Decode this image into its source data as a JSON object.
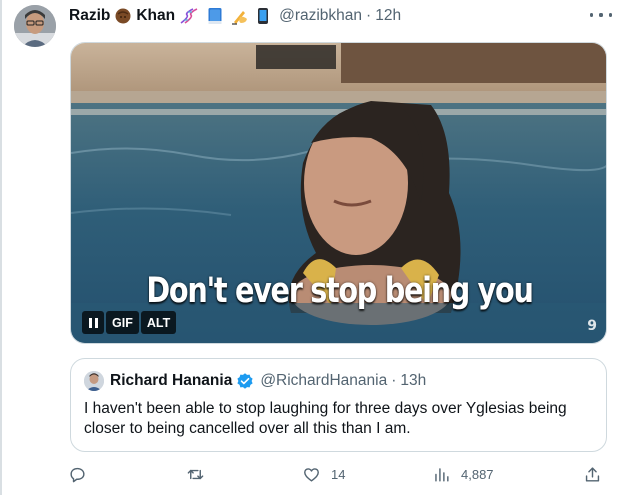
{
  "tweet": {
    "author": {
      "display_name": "Razib",
      "display_name_suffix": "Khan",
      "handle": "@razibkhan",
      "timestamp": "12h",
      "name_emojis": [
        "coconut-icon",
        "dna-icon",
        "book-icon",
        "writing-hand-icon",
        "phone-icon"
      ]
    },
    "separator": "·",
    "media": {
      "caption": "Don't ever stop being you",
      "controls": {
        "gif_label": "GIF",
        "alt_label": "ALT"
      },
      "watermark": "9"
    },
    "quoted": {
      "display_name": "Richard Hanania",
      "handle": "@RichardHanania",
      "timestamp": "13h",
      "verified": true,
      "text": "I haven't been able to stop laughing for three days over Yglesias being closer to being cancelled over all this than I am."
    },
    "actions": {
      "reply_count": "",
      "retweet_count": "",
      "like_count": "14",
      "views_count": "4,887"
    }
  },
  "colors": {
    "text": "#0f1419",
    "secondary": "#536471",
    "border": "#cfd9de",
    "verified": "#1d9bf0"
  }
}
